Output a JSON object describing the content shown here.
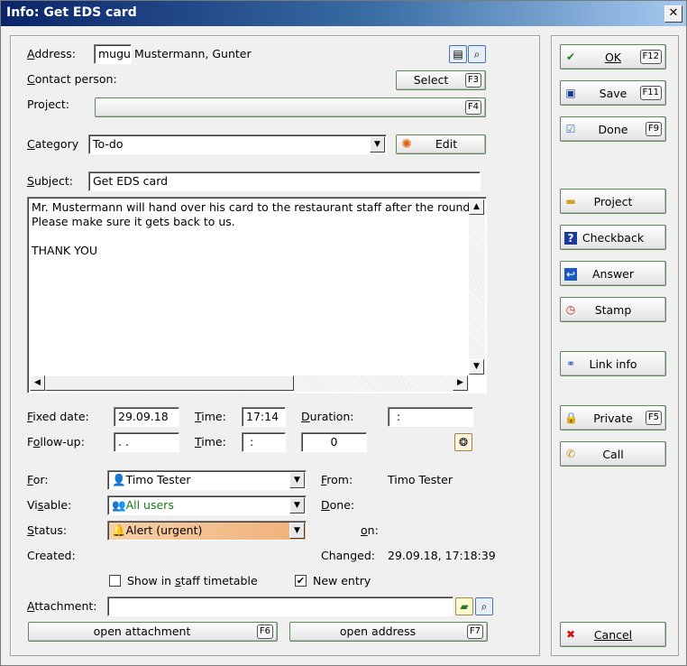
{
  "window": {
    "title": "Info: Get EDS card",
    "close": "✕"
  },
  "address": {
    "label": "Address:",
    "code": "mugu",
    "name": "Mustermann, Gunter"
  },
  "contact": {
    "label": "Contact person:",
    "select_btn": "Select",
    "select_key": "F3"
  },
  "project": {
    "label": "Project:",
    "key": "F4"
  },
  "category": {
    "label": "Category",
    "value": "To-do",
    "edit_btn": "Edit"
  },
  "subject": {
    "label": "Subject:",
    "value": "Get EDS card"
  },
  "notes": {
    "line1": "Mr. Mustermann will hand over his card to the restaurant staff after the round.",
    "line2": "Please make sure it gets back to us.",
    "line3": "THANK YOU"
  },
  "dates": {
    "fixed_label": "Fixed date:",
    "fixed_value": "29.09.18",
    "time_label": "Time:",
    "fixed_time": "17:14",
    "duration_label": "Duration:",
    "duration_value": ":",
    "followup_label": "Follow-up:",
    "followup_value": ". .",
    "followup_time": ":",
    "followup_count": "0"
  },
  "assign": {
    "for_label": "For:",
    "for_value": "Timo Tester",
    "from_label": "From:",
    "from_value": "Timo Tester",
    "visible_label": "Visable:",
    "visible_value": "All users",
    "done_label": "Done:",
    "status_label": "Status:",
    "status_value": "Alert (urgent)",
    "on_label": "on:",
    "created_label": "Created:",
    "changed_label": "Changed:",
    "changed_value": "29.09.18, 17:18:39"
  },
  "options": {
    "staff_timetable": "Show in staff timetable",
    "new_entry": "New entry",
    "new_entry_checked": "✔"
  },
  "attachment": {
    "label": "Attachment:",
    "open_attachment": "open attachment",
    "open_attachment_key": "F6",
    "open_address": "open address",
    "open_address_key": "F7"
  },
  "side": {
    "ok": "OK",
    "ok_key": "F12",
    "save": "Save",
    "save_key": "F11",
    "done": "Done",
    "done_key": "F9",
    "project": "Project",
    "checkback": "Checkback",
    "answer": "Answer",
    "stamp": "Stamp",
    "link_info": "Link info",
    "private": "Private",
    "private_key": "F5",
    "call": "Call",
    "cancel": "Cancel"
  },
  "colors": {
    "title_start": "#0a246a",
    "title_end": "#a6caf0",
    "status_bg": "#f8c898",
    "visible_text": "#1a7a1a"
  }
}
